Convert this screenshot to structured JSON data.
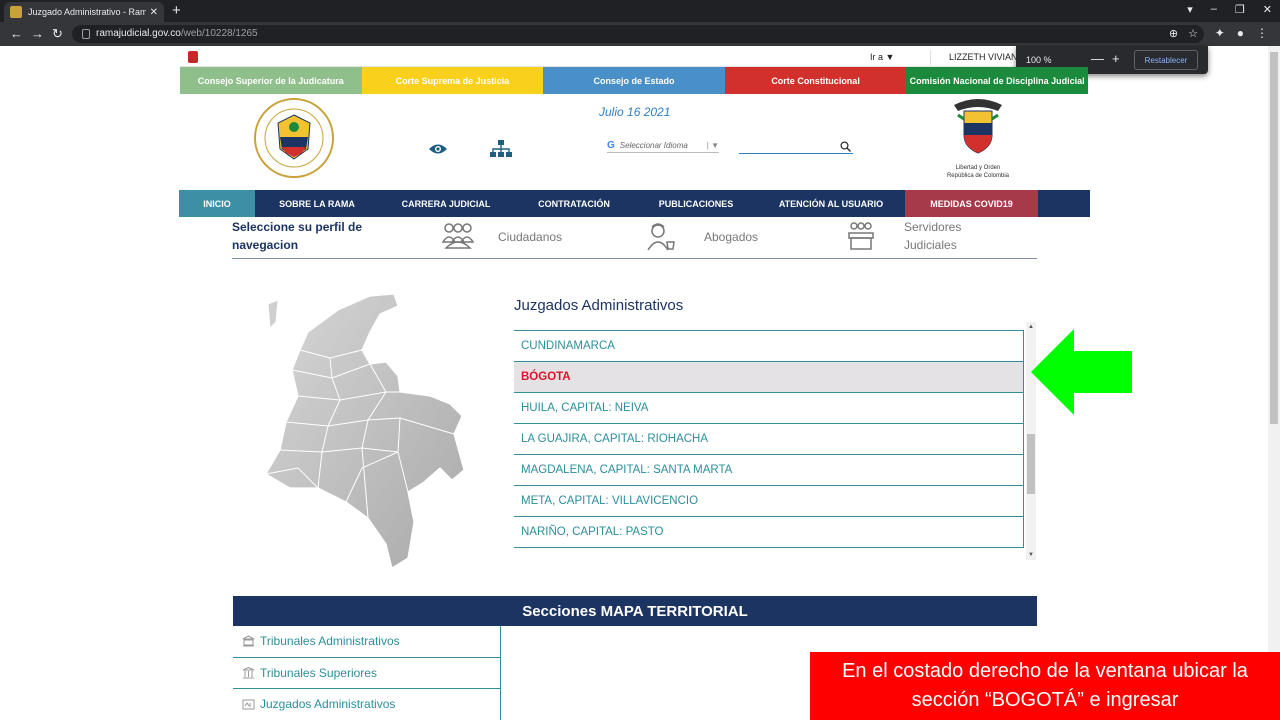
{
  "browser": {
    "tab_title": "Juzgado Administrativo - Rama J",
    "tab_close": "✕",
    "new_tab": "+",
    "back": "←",
    "forward": "→",
    "reload": "↻",
    "url_host": "ramajudicial.gov.co",
    "url_path": "/web/10228/1265",
    "zoom_icon": "⊕",
    "star_icon": "☆",
    "extension_icon": "✦",
    "profile_icon": "●",
    "menu_icon": "⋮",
    "win_min": "–",
    "win_restore": "❐",
    "win_close": "✕",
    "media_icon": "▾"
  },
  "zoom_popup": {
    "level": "100 %",
    "minus": "—",
    "plus": "+",
    "reset": "Restablecer"
  },
  "top_strip": {
    "goto": "Ir a ▼",
    "user": "LIZZETH VIVIAN"
  },
  "corporations": [
    {
      "label": "Consejo Superior de la Judicatura",
      "color": "#8fbf8b"
    },
    {
      "label": "Corte Suprema de Justicia",
      "color": "#f9d11c"
    },
    {
      "label": "Consejo de Estado",
      "color": "#4a90c8"
    },
    {
      "label": "Corte Constitucional",
      "color": "#d1302c"
    },
    {
      "label": "Comisión Nacional de Disciplina Judicial",
      "color": "#1b8a3c"
    }
  ],
  "header": {
    "date": "Julio 16 2021",
    "translate_label": "Seleccionar Idioma",
    "translate_g": "G",
    "translate_caret": "| ▼",
    "seal_caption_1": "Libertad y Orden",
    "seal_caption_2": "República de Colombia"
  },
  "main_nav": [
    {
      "label": "INICIO",
      "color": "#3d8fa6"
    },
    {
      "label": "SOBRE LA RAMA",
      "color": "#1c3462"
    },
    {
      "label": "CARRERA JUDICIAL",
      "color": "#1c3462"
    },
    {
      "label": "CONTRATACIÓN",
      "color": "#1c3462"
    },
    {
      "label": "PUBLICACIONES",
      "color": "#1c3462"
    },
    {
      "label": "ATENCIÓN AL USUARIO",
      "color": "#1c3462"
    },
    {
      "label": "MEDIDAS COVID19",
      "color": "#a63a4b"
    }
  ],
  "profile": {
    "title": "Seleccione su perfil de navegacion",
    "ciudadanos": "Ciudadanos",
    "abogados": "Abogados",
    "servidores": "Servidores Judiciales"
  },
  "jurisdiction": {
    "title": "Juzgados Administrativos",
    "items": [
      "CUNDINAMARCA",
      "BÓGOTA",
      "HUILA, CAPITAL: NEIVA",
      "LA GUAJIRA, CAPITAL: RIOHACHA",
      "MAGDALENA, CAPITAL: SANTA MARTA",
      "META, CAPITAL: VILLAVICENCIO",
      "NARIÑO, CAPITAL: PASTO"
    ],
    "selected": "BÓGOTA",
    "scroll_up": "▲",
    "scroll_down": "▼"
  },
  "sections": {
    "title": "Secciones MAPA TERRITORIAL",
    "items": [
      "Tribunales Administrativos",
      "Tribunales Superiores",
      "Juzgados Administrativos"
    ]
  },
  "instruction": {
    "line1": "En el costado derecho de la ventana ubicar la",
    "line2": "sección “BOGOTÁ” e ingresar"
  },
  "colors": {
    "navy": "#1c3462",
    "teal": "#2c8e9c",
    "selected_red": "#e0112b",
    "arrow_green": "#00ff00",
    "overlay_red": "#ff0000"
  }
}
